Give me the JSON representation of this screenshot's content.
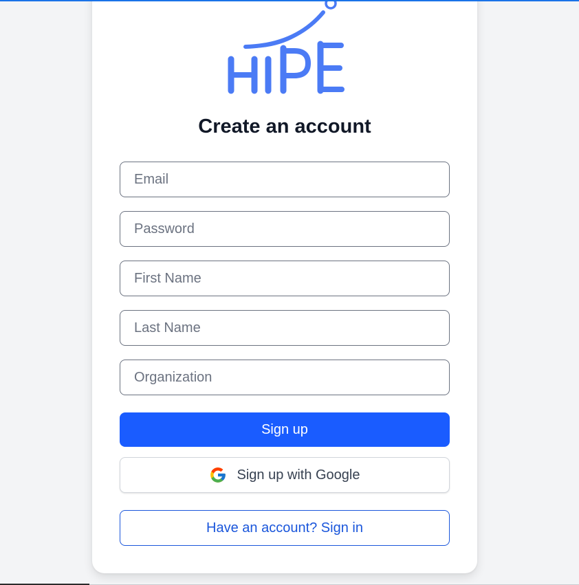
{
  "brand": {
    "logo_text": "HIPE",
    "color": "#4b7bf5"
  },
  "page": {
    "title": "Create an account"
  },
  "form": {
    "email_placeholder": "Email",
    "password_placeholder": "Password",
    "first_name_placeholder": "First Name",
    "last_name_placeholder": "Last Name",
    "organization_placeholder": "Organization"
  },
  "actions": {
    "signup_label": "Sign up",
    "google_label": "Sign up with Google",
    "google_icon": "google-g-icon",
    "signin_label": "Have an account? Sign in"
  },
  "colors": {
    "primary": "#1a5cff",
    "link": "#1a56db",
    "background": "#f3f4f6"
  }
}
